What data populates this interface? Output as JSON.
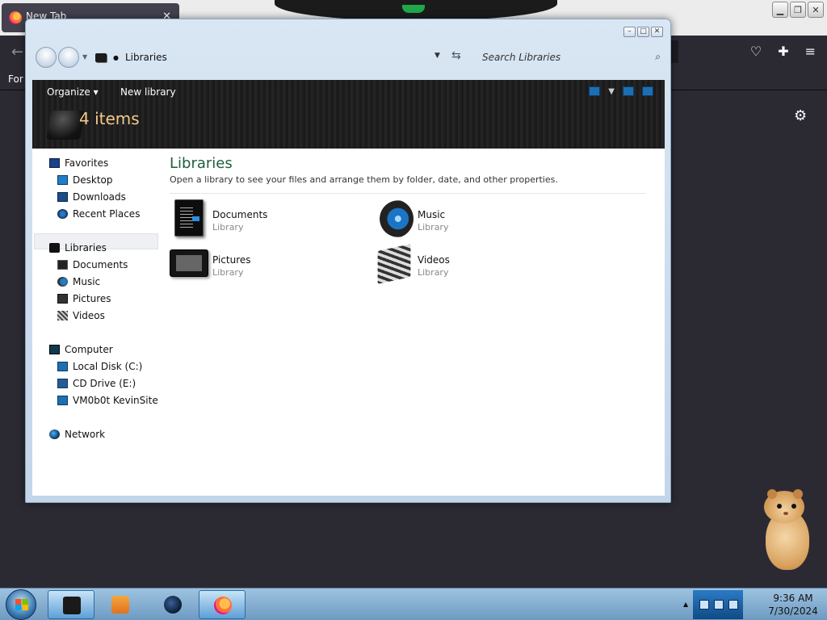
{
  "firefox": {
    "tab_title": "New Tab",
    "bookmarks_label": "For"
  },
  "explorer": {
    "address": {
      "current": "Libraries"
    },
    "search": {
      "placeholder": "Search Libraries"
    },
    "toolbar": {
      "organize_label": "Organize",
      "new_library_label": "New library",
      "item_count": "4 items"
    },
    "nav": {
      "favorites": {
        "label": "Favorites",
        "items": [
          {
            "label": "Desktop"
          },
          {
            "label": "Downloads"
          },
          {
            "label": "Recent Places"
          }
        ]
      },
      "libraries": {
        "label": "Libraries",
        "items": [
          {
            "label": "Documents"
          },
          {
            "label": "Music"
          },
          {
            "label": "Pictures"
          },
          {
            "label": "Videos"
          }
        ]
      },
      "computer": {
        "label": "Computer",
        "items": [
          {
            "label": "Local Disk (C:)"
          },
          {
            "label": "CD Drive (E:)"
          },
          {
            "label": "VM0b0t KevinSite"
          }
        ]
      },
      "network": {
        "label": "Network"
      }
    },
    "content": {
      "title": "Libraries",
      "subtitle": "Open a library to see your files and arrange them by folder, date, and other properties.",
      "libraries": [
        {
          "name": "Documents",
          "type": "Library",
          "icon": "documents-library-icon"
        },
        {
          "name": "Music",
          "type": "Library",
          "icon": "music-library-icon"
        },
        {
          "name": "Pictures",
          "type": "Library",
          "icon": "pictures-library-icon"
        },
        {
          "name": "Videos",
          "type": "Library",
          "icon": "videos-library-icon"
        }
      ]
    }
  },
  "taskbar": {
    "clock": {
      "time": "9:36 AM",
      "date": "7/30/2024"
    },
    "apps": [
      "libraries-explorer",
      "media-player",
      "globe-app",
      "firefox"
    ]
  }
}
